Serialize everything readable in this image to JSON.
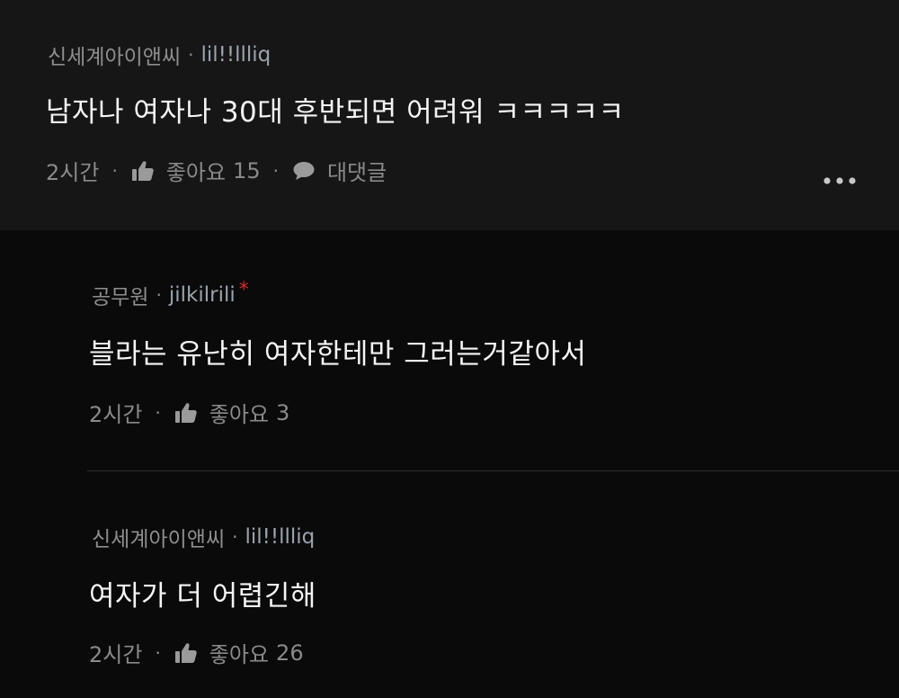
{
  "comments": [
    {
      "name": "신세계아이앤씨",
      "nickname": "lil!!llliq",
      "text": "남자나 여자나 30대 후반되면 어려워 ㅋㅋㅋㅋㅋ",
      "time": "2시간",
      "like_label": "좋아요",
      "like_count": "15",
      "reply_label": "대댓글"
    },
    {
      "name": "공무원",
      "nickname": "jilkilrili",
      "badge": "*",
      "text": "블라는 유난히 여자한테만 그러는거같아서",
      "time": "2시간",
      "like_label": "좋아요",
      "like_count": "3"
    },
    {
      "name": "신세계아이앤씨",
      "nickname": "lil!!llliq",
      "text": "여자가 더 어렵긴해",
      "time": "2시간",
      "like_label": "좋아요",
      "like_count": "26"
    }
  ],
  "separator": "·",
  "icons": {
    "like": "thumbs-up-icon",
    "reply": "speech-bubble-icon",
    "more": "more-dots-icon"
  },
  "colors": {
    "background": "#0a0a0a",
    "top_comment_background": "#161616",
    "badge": "#e0242b"
  }
}
